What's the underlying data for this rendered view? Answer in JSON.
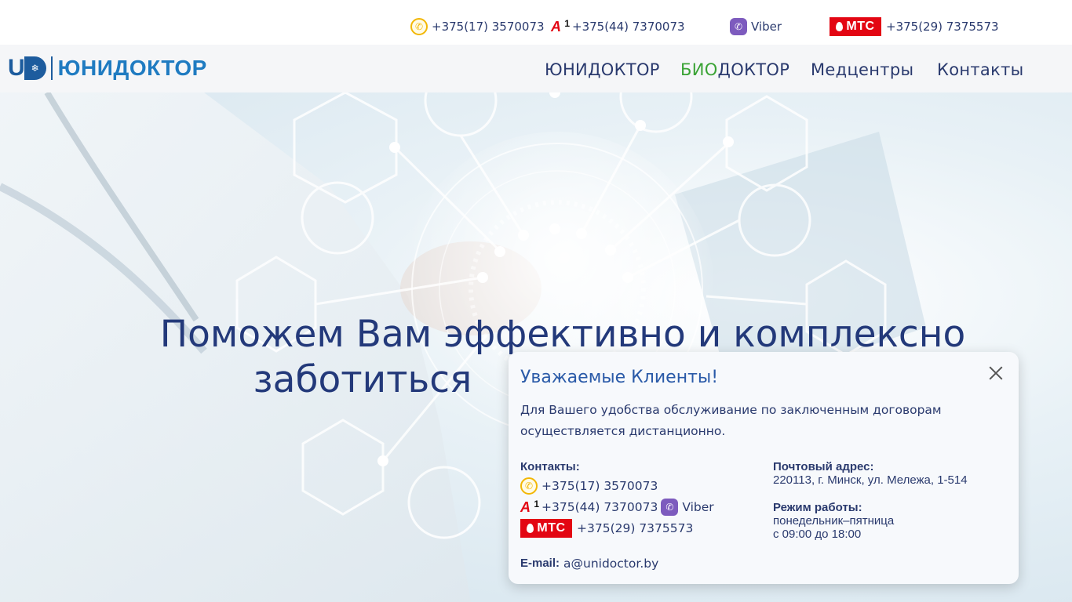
{
  "topbar": {
    "phone_city": "+375(17) 3570073",
    "phone_a1": "+375(44) 7370073",
    "viber_label": "Viber",
    "phone_mts": "+375(29) 7375573",
    "mts_label": "МТС",
    "a1_label": "A",
    "a1_sup": "1"
  },
  "logo": {
    "mark_u": "U",
    "mark_d": "❄",
    "text": "ЮНИДОКТОР"
  },
  "nav": {
    "items": [
      {
        "label": "ЮНИДОКТОР"
      },
      {
        "label_prefix": "БИО",
        "label_suffix": "ДОКТОР"
      },
      {
        "label": "Медцентры"
      },
      {
        "label": "Контакты"
      }
    ]
  },
  "hero": {
    "title_line1": "Поможем Вам эффективно и комплексно",
    "title_line2": "заботиться"
  },
  "modal": {
    "title": "Уважаемые Клиенты!",
    "body": "Для Вашего удобства обслуживание по заключенным договорам осуществляется дистанционно.",
    "contacts_label": "Контакты:",
    "phone_city": "+375(17) 3570073",
    "phone_a1": "+375(44) 7370073",
    "viber_label": "Viber",
    "phone_mts": "+375(29) 7375573",
    "mts_label": "МТС",
    "email_label": "E-mail:",
    "email": "a@unidoctor.by",
    "address_label": "Почтовый адрес:",
    "address": "220113, г. Минск, ул. Мележа, 1-514",
    "hours_label": "Режим работы:",
    "hours_days": "понедельник–пятница",
    "hours_time": "с 09:00 до 18:00"
  },
  "colors": {
    "brand_blue": "#1f7bc1",
    "navy_text": "#2a3a6e",
    "bio_green": "#3aa335",
    "mts_red": "#e30613",
    "viber_purple": "#7d5bbe"
  }
}
